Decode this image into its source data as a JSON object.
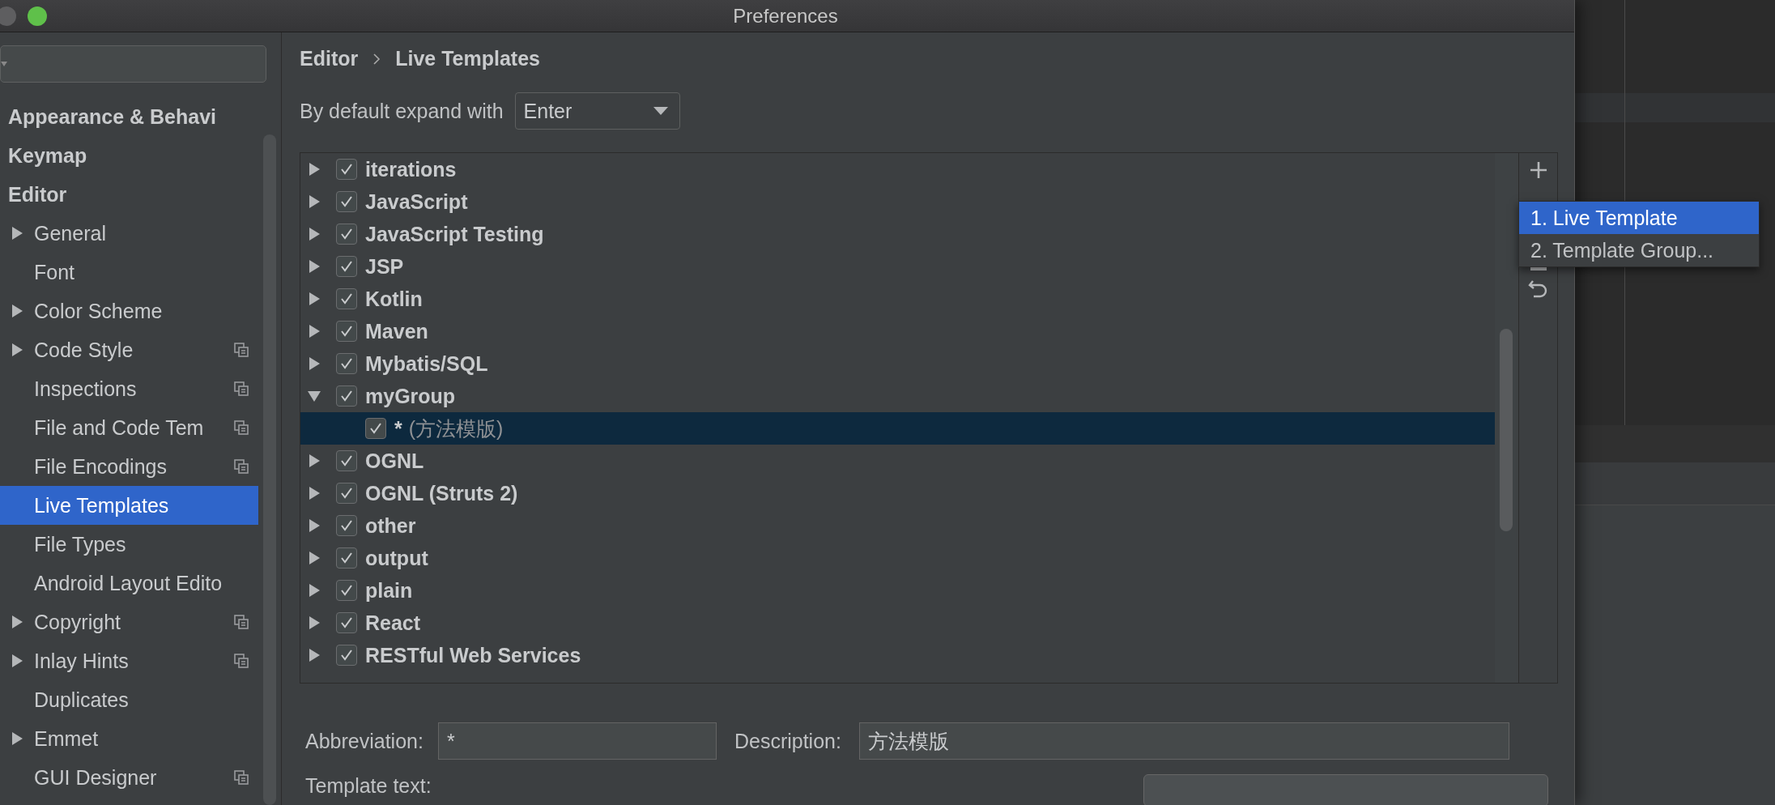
{
  "window": {
    "title": "Preferences"
  },
  "sidebar": {
    "items": [
      {
        "label": "Appearance & Behavi",
        "selected": false
      },
      {
        "label": "Keymap",
        "selected": false
      },
      {
        "label": "Editor",
        "selected": false,
        "children": [
          {
            "label": "General",
            "expanded": false,
            "project": false,
            "selected": false
          },
          {
            "label": "Font",
            "project": false,
            "selected": false
          },
          {
            "label": "Color Scheme",
            "expanded": false,
            "project": false,
            "selected": false
          },
          {
            "label": "Code Style",
            "expanded": false,
            "project": true,
            "selected": false
          },
          {
            "label": "Inspections",
            "project": true,
            "selected": false
          },
          {
            "label": "File and Code Tem",
            "project": true,
            "selected": false
          },
          {
            "label": "File Encodings",
            "project": true,
            "selected": false
          },
          {
            "label": "Live Templates",
            "project": false,
            "selected": true
          },
          {
            "label": "File Types",
            "project": false,
            "selected": false
          },
          {
            "label": "Android Layout Edito",
            "project": false,
            "selected": false
          },
          {
            "label": "Copyright",
            "expanded": false,
            "project": true,
            "selected": false
          },
          {
            "label": "Inlay Hints",
            "expanded": false,
            "project": true,
            "selected": false
          },
          {
            "label": "Duplicates",
            "project": false,
            "selected": false
          },
          {
            "label": "Emmet",
            "expanded": false,
            "project": false,
            "selected": false
          },
          {
            "label": "GUI Designer",
            "project": true,
            "selected": false
          }
        ]
      }
    ]
  },
  "breadcrumb": [
    "Editor",
    "Live Templates"
  ],
  "expand_with": {
    "label": "By default expand with",
    "value": "Enter"
  },
  "templates": [
    {
      "label": "iterations",
      "checked": true,
      "expanded": false
    },
    {
      "label": "JavaScript",
      "checked": true,
      "expanded": false
    },
    {
      "label": "JavaScript Testing",
      "checked": true,
      "expanded": false
    },
    {
      "label": "JSP",
      "checked": true,
      "expanded": false
    },
    {
      "label": "Kotlin",
      "checked": true,
      "expanded": false
    },
    {
      "label": "Maven",
      "checked": true,
      "expanded": false
    },
    {
      "label": "Mybatis/SQL",
      "checked": true,
      "expanded": false
    },
    {
      "label": "myGroup",
      "checked": true,
      "expanded": true,
      "children": [
        {
          "abbreviation": "*",
          "description": "(方法模版)",
          "checked": true,
          "selected": true
        }
      ]
    },
    {
      "label": "OGNL",
      "checked": true,
      "expanded": false
    },
    {
      "label": "OGNL (Struts 2)",
      "checked": true,
      "expanded": false
    },
    {
      "label": "other",
      "checked": true,
      "expanded": false
    },
    {
      "label": "output",
      "checked": true,
      "expanded": false
    },
    {
      "label": "plain",
      "checked": true,
      "expanded": false
    },
    {
      "label": "React",
      "checked": true,
      "expanded": false
    },
    {
      "label": "RESTful Web Services",
      "checked": true,
      "expanded": false
    }
  ],
  "add_menu": [
    {
      "label": "1. Live Template",
      "selected": true
    },
    {
      "label": "2. Template Group...",
      "selected": false
    }
  ],
  "abbreviation": {
    "label": "Abbreviation:",
    "value": "*"
  },
  "description": {
    "label": "Description:",
    "value": "方法模版"
  },
  "template_text": {
    "label": "Template text:"
  }
}
